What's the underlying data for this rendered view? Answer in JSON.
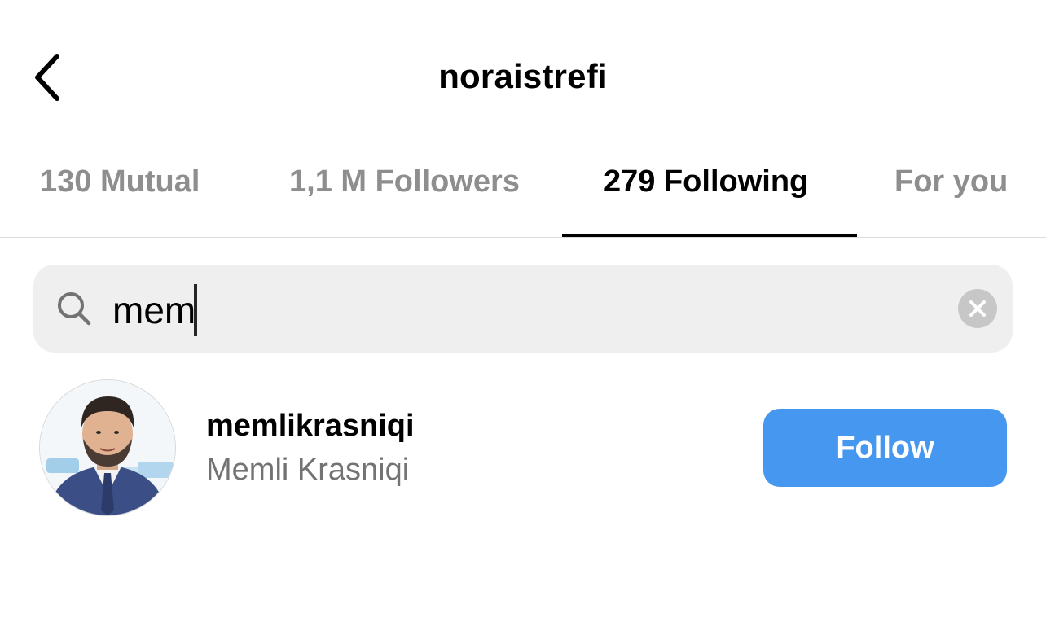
{
  "header": {
    "back_icon": "chevron-left-icon",
    "title": "noraistrefi"
  },
  "tabs": [
    {
      "label": "130 Mutual",
      "active": false
    },
    {
      "label": "1,1 M Followers",
      "active": false
    },
    {
      "label": "279 Following",
      "active": true
    },
    {
      "label": "For you",
      "active": false
    }
  ],
  "search": {
    "icon": "search-icon",
    "value": "mem",
    "clear_icon": "clear-circle-icon"
  },
  "results": [
    {
      "username": "memlikrasniqi",
      "full_name": "Memli Krasniqi",
      "button_label": "Follow"
    }
  ],
  "colors": {
    "follow_button": "#4697f0",
    "inactive_tab": "#8e8e8e",
    "search_bg": "#efefef"
  }
}
